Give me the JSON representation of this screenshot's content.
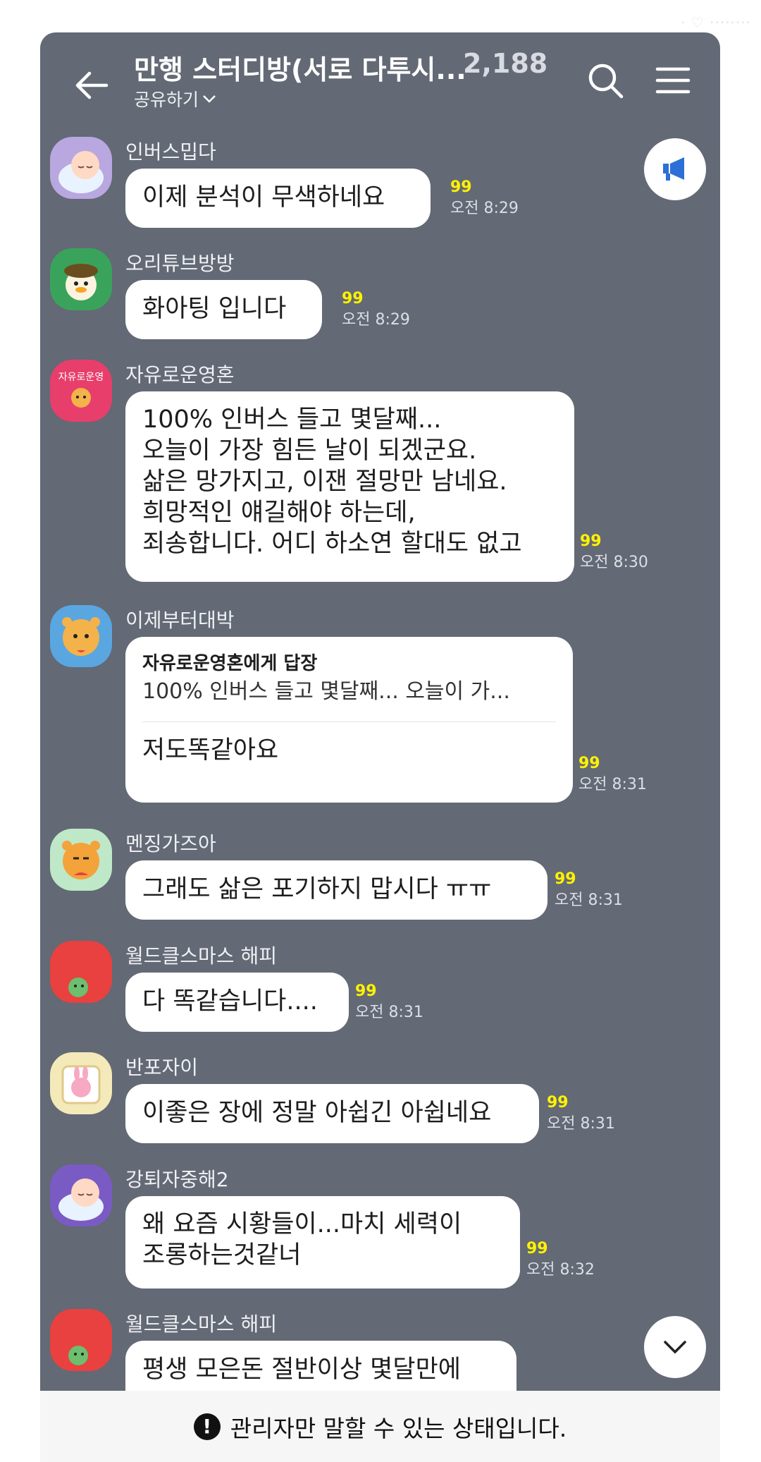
{
  "watermark": "· ♡ ········",
  "header": {
    "title": "만행 스터디방(서로 다투시...",
    "member_count": "2,188",
    "share_label": "공유하기"
  },
  "messages": [
    {
      "sender": "인버스밉다",
      "lines": [
        "이제 분석이 무색하네요"
      ],
      "unread": "99",
      "time": "오전 8:29",
      "avatar_color": "#b9a7e0"
    },
    {
      "sender": "오리튜브방방",
      "lines": [
        "화아팅 입니다"
      ],
      "unread": "99",
      "time": "오전 8:29",
      "avatar_color": "#3aa35b"
    },
    {
      "sender": "자유로운영혼",
      "avatar_text": "자유로운영",
      "lines": [
        "100% 인버스 들고 몇달째...",
        "오늘이 가장 힘든 날이 되겠군요.",
        "삶은 망가지고, 이잰 절망만 남네요.",
        "희망적인 얘길해야 하는데,",
        "죄송합니다. 어디 하소연 할대도 없고"
      ],
      "unread": "99",
      "time": "오전 8:30",
      "avatar_color": "#e83e6b"
    },
    {
      "sender": "이제부터대박",
      "reply_to": "자유로운영혼에게 답장",
      "reply_quote": "100% 인버스 들고 몇달째... 오늘이 가...",
      "lines": [
        "저도똑같아요"
      ],
      "unread": "99",
      "time": "오전 8:31",
      "avatar_color": "#5aa6e0"
    },
    {
      "sender": "멘징가즈아",
      "lines": [
        "그래도 삶은 포기하지 맙시다 ㅠㅠ"
      ],
      "unread": "99",
      "time": "오전 8:31",
      "avatar_color": "#bfe8c9"
    },
    {
      "sender": "월드클스마스 해피",
      "lines": [
        "다 똑같습니다...."
      ],
      "unread": "99",
      "time": "오전 8:31",
      "avatar_color": "#e8413f"
    },
    {
      "sender": "반포자이",
      "lines": [
        "이좋은 장에 정말 아쉽긴 아쉽네요"
      ],
      "unread": "99",
      "time": "오전 8:31",
      "avatar_color": "#f4e9b8"
    },
    {
      "sender": "강퇴자중해2",
      "lines": [
        "왜 요즘 시황들이...마치 세력이",
        "조롱하는것같너"
      ],
      "unread": "99",
      "time": "오전 8:32",
      "avatar_color": "#7a5bc4"
    },
    {
      "sender": "월드클스마스 해피",
      "lines": [
        "평생 모은돈 절반이상 몇달만에"
      ],
      "avatar_color": "#e8413f"
    }
  ],
  "bottom_bar": {
    "alert_glyph": "!",
    "text": "관리자만 말할 수 있는 상태입니다."
  },
  "colors": {
    "chat_background": "#636975",
    "bubble": "#ffffff",
    "unread": "#fff200"
  }
}
